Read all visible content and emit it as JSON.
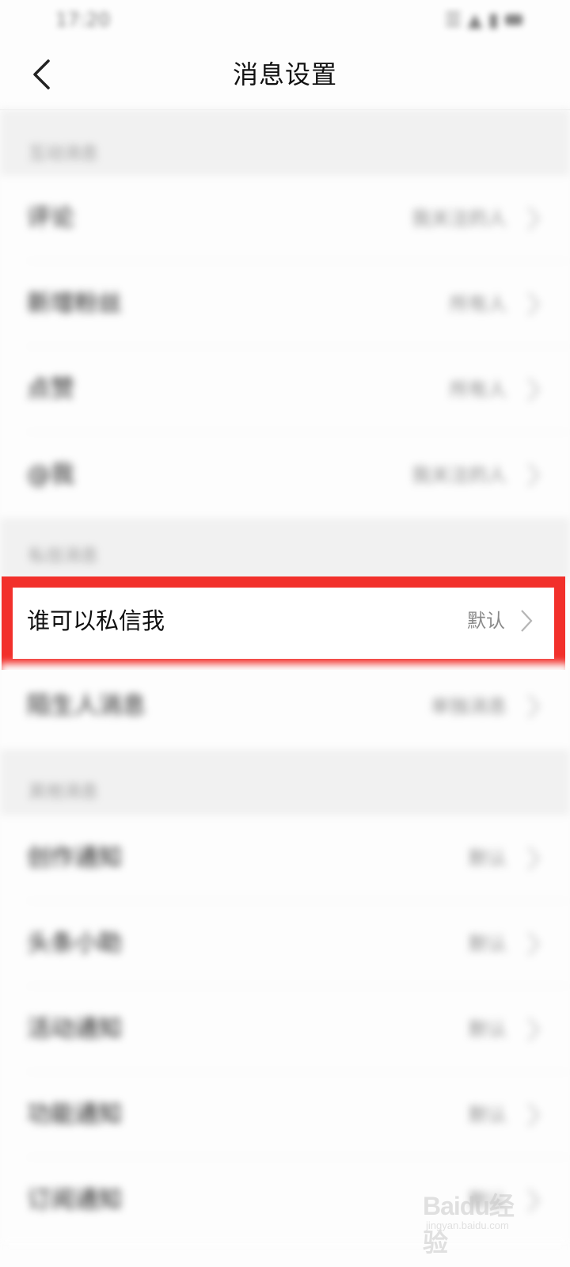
{
  "status_bar": {
    "time": "17:20",
    "indicators": "☰ ▲ ▮"
  },
  "header": {
    "title": "消息设置",
    "back_icon": "chevron-left-icon"
  },
  "sections": [
    {
      "label": "互动消息",
      "rows": [
        {
          "label": "评论",
          "value": "我关注的人"
        },
        {
          "label": "新增粉丝",
          "value": "所有人"
        },
        {
          "label": "点赞",
          "value": "所有人"
        },
        {
          "label": "@我",
          "value": "我关注的人"
        }
      ]
    },
    {
      "label": "私信消息",
      "rows": [
        {
          "label": "谁可以私信我",
          "value": "默认"
        },
        {
          "label": "陌生人消息",
          "value": "单独消息"
        }
      ]
    },
    {
      "label": "其他消息",
      "rows": [
        {
          "label": "创作通知",
          "value": "默认"
        },
        {
          "label": "头条小助",
          "value": "默认"
        },
        {
          "label": "活动通知",
          "value": "默认"
        },
        {
          "label": "功能通知",
          "value": "默认"
        },
        {
          "label": "订阅通知",
          "value": "默认"
        }
      ]
    }
  ],
  "highlight": {
    "color": "#f2302b"
  },
  "watermark": {
    "logo": "Baidu经验",
    "url": "jingyan.baidu.com"
  }
}
